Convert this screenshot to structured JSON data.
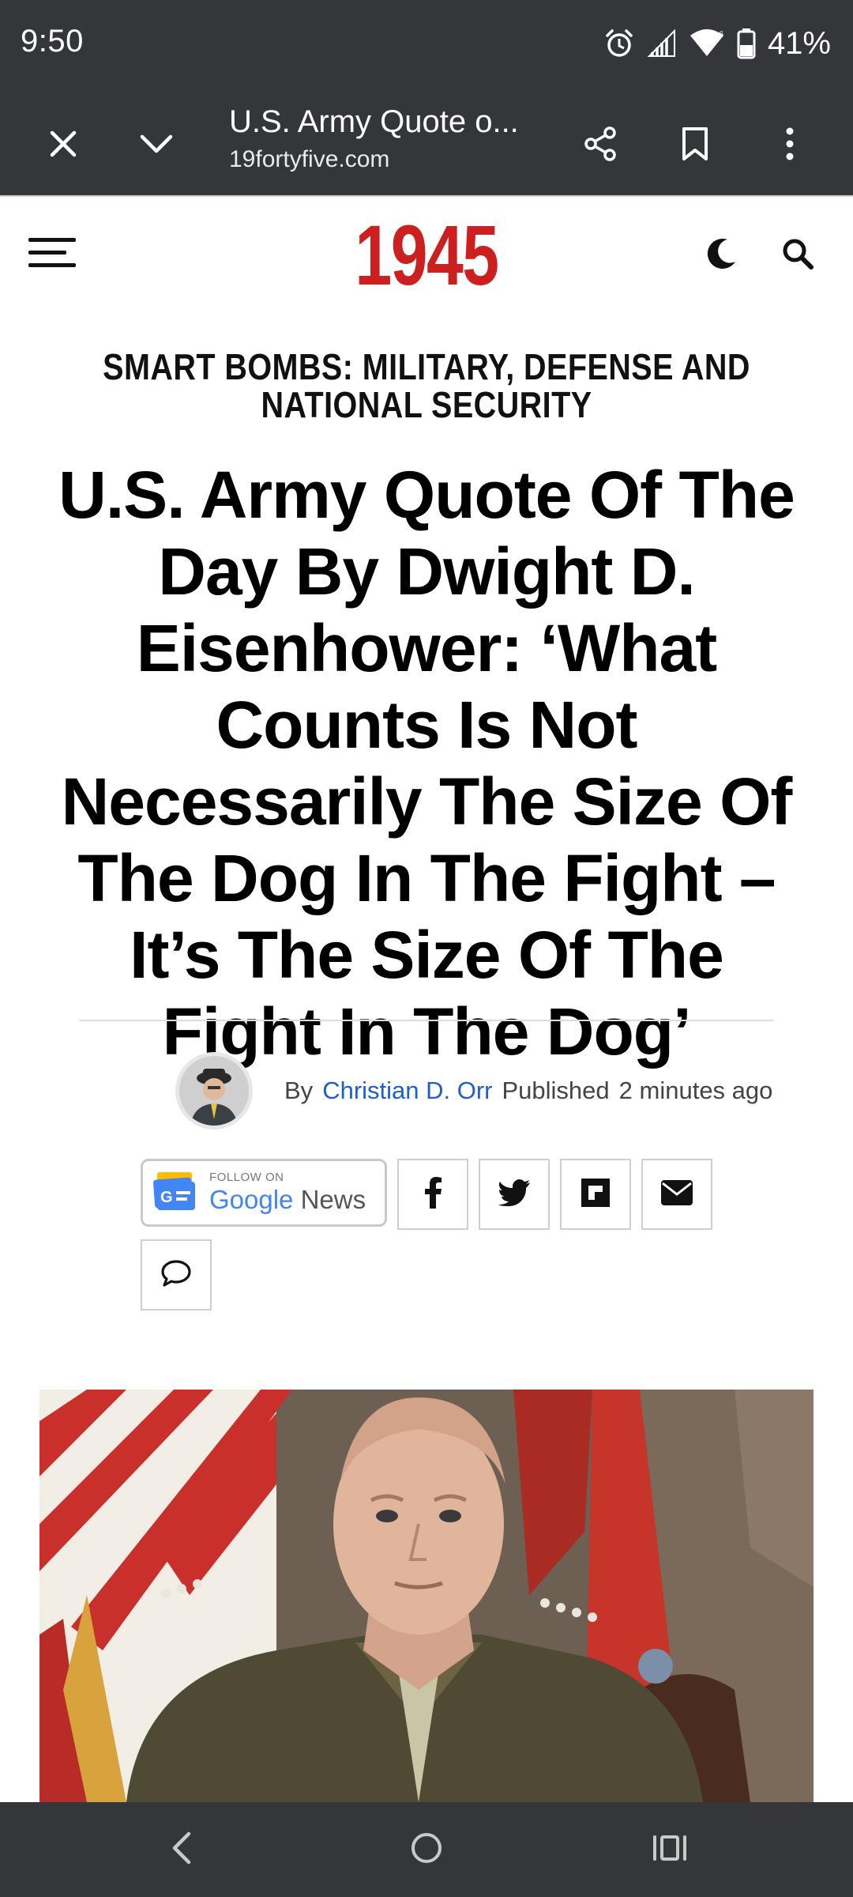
{
  "status_bar": {
    "time": "9:50",
    "battery": "41%",
    "icons": [
      "alarm-icon",
      "signal-icon",
      "wifi-icon",
      "battery-icon"
    ]
  },
  "toolbar": {
    "tab_title": "U.S. Army Quote o...",
    "url": "19fortyfive.com",
    "icons": [
      "close-icon",
      "chevron-down-icon",
      "share-icon",
      "bookmark-icon",
      "more-vert-icon"
    ]
  },
  "site": {
    "logo": "1945",
    "logo_color": "#cc1f1f",
    "icons": [
      "menu-icon",
      "moon-icon",
      "search-icon"
    ]
  },
  "article": {
    "category": "SMART BOMBS: MILITARY, DEFENSE AND NATIONAL SECURITY",
    "headline": "U.S. Army Quote Of The Day By Dwight D. Eisenhower: ‘What Counts Is Not Necessarily The Size Of The Dog In The Fight – It’s The Size Of The Fight In The Dog’",
    "byline": {
      "by": "By",
      "author": "Christian D. Orr",
      "published_label": "Published",
      "time_ago": "2 minutes ago",
      "author_color": "#1f5fc9"
    },
    "share": {
      "gnews_small": "FOLLOW ON",
      "gnews_google": "Google",
      "gnews_news": "News",
      "buttons": [
        "facebook-icon",
        "twitter-icon",
        "flipboard-icon",
        "email-icon",
        "comment-icon"
      ]
    }
  },
  "nav_bar": {
    "icons": [
      "back-icon",
      "home-icon",
      "recents-icon"
    ]
  }
}
